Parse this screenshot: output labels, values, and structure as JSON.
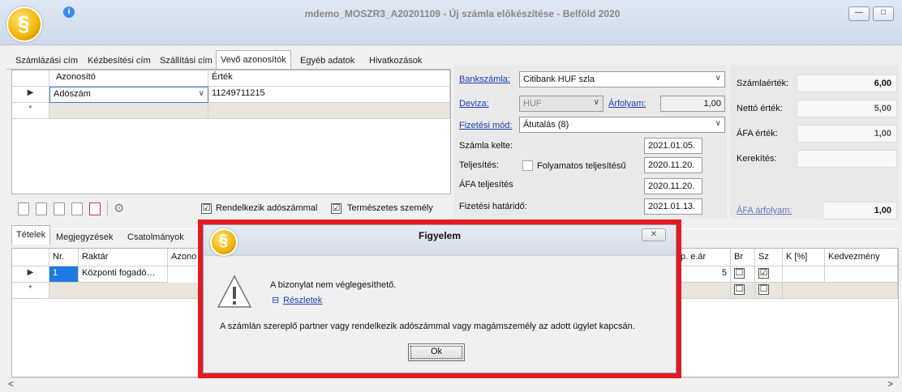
{
  "window": {
    "title": "mdemo_MOSZR3_A20201109 - Új számla előkészítése - Belföld 2020",
    "info": "i",
    "min": "—",
    "max": "□"
  },
  "top_tabs": [
    "Számlázási cím",
    "Kézbesítési cím",
    "Szállítási cím",
    "Vevő azonosítók",
    "Egyéb adatok",
    "Hivatkozások"
  ],
  "ids_grid": {
    "headers": [
      "Azonosító",
      "Érték"
    ],
    "row": {
      "indicator": "▶",
      "type": "Adószám",
      "value": "11249711215"
    },
    "new_indicator": "*"
  },
  "checks": {
    "has_tax_label": "Rendelkezik adószámmal",
    "has_tax": "☑",
    "natural_label": "Természetes személy",
    "natural": "☑"
  },
  "bank": {
    "label": "Bankszámla:",
    "value": "Citibank HUF szla"
  },
  "currency": {
    "label": "Deviza:",
    "value": "HUF",
    "rate_label": "Árfolyam:",
    "rate": "1,00"
  },
  "payment": {
    "label": "Fizetési mód:",
    "value": "Átutalás (8)"
  },
  "dates": {
    "invoice_label": "Számla kelte:",
    "invoice": "2021.01.05.",
    "perf_label": "Teljesítés:",
    "continuous_label": "Folyamatos teljesítésű",
    "perf": "2020.11.20.",
    "vat_label": "ÁFA teljesítés",
    "vat": "2020.11.20.",
    "due_label": "Fizetési határidő:",
    "due": "2021.01.13."
  },
  "totals": {
    "invoice_value_label": "Számlaérték:",
    "invoice_value": "6,00",
    "net_label": "Nettó érték:",
    "net": "5,00",
    "vat_label": "ÁFA érték:",
    "vat": "1,00",
    "rounding_label": "Kerekítés:",
    "rounding": "",
    "vat_rate_label": "ÁFA árfolyam:",
    "vat_rate": "1,00"
  },
  "bottom_tabs": [
    "Tételek",
    "Megjegyzések",
    "Csatolmányok"
  ],
  "items_grid": {
    "headers": [
      "Nr.",
      "Raktár",
      "Azono",
      "p. e.ár",
      "Br",
      "Sz",
      "K [%]",
      "Kedvezmény"
    ],
    "row": {
      "indicator": "▶",
      "nr": "1",
      "warehouse": "Központi fogadó…",
      "price": "5",
      "br": "☐",
      "sz": "☑"
    },
    "new_indicator": "*",
    "new_br": "☐",
    "new_sz": "☐"
  },
  "dialog": {
    "title": "Figyelem",
    "close": "✕",
    "message": "A bizonylat nem véglegesíthető.",
    "details_toggle": "⊟",
    "details": "Részletek",
    "detail_text": "A számlán szereplő partner vagy rendelkezik adószámmal vagy magámszemély az adott ügylet kapcsán.",
    "ok": "Ok"
  },
  "scroll": {
    "left": "<",
    "right": ">"
  }
}
